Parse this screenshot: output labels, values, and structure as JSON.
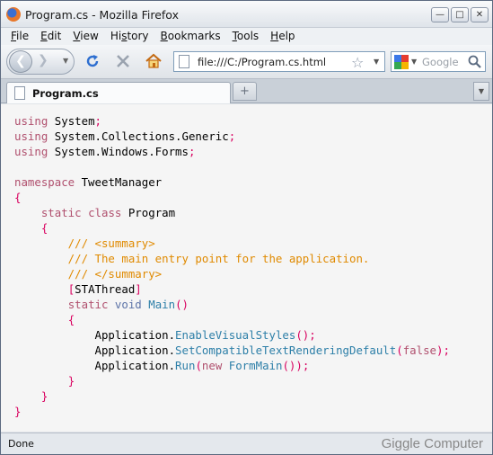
{
  "window": {
    "title": "Program.cs - Mozilla Firefox",
    "buttons": [
      "minimize",
      "maximize",
      "close"
    ]
  },
  "menubar": {
    "items": [
      {
        "label": "File",
        "key": "F",
        "rest": "ile"
      },
      {
        "label": "Edit",
        "key": "E",
        "rest": "dit"
      },
      {
        "label": "View",
        "key": "V",
        "rest": "iew"
      },
      {
        "label": "History",
        "key": "S",
        "pre": "Hi",
        "rest": "tory"
      },
      {
        "label": "Bookmarks",
        "key": "B",
        "rest": "ookmarks"
      },
      {
        "label": "Tools",
        "key": "T",
        "rest": "ools"
      },
      {
        "label": "Help",
        "key": "H",
        "rest": "elp"
      }
    ]
  },
  "navbar": {
    "url": "file:///C:/Program.cs.html",
    "search_placeholder": "Google",
    "icons": [
      "back-icon",
      "forward-icon",
      "reload-icon",
      "stop-icon",
      "home-icon",
      "bookmark-star-icon",
      "google-icon",
      "magnifier-icon"
    ]
  },
  "tabs": [
    {
      "label": "Program.cs",
      "active": true
    }
  ],
  "newtab_symbol": "+",
  "code": {
    "language": "C#",
    "lines": [
      "using System;",
      "using System.Collections.Generic;",
      "using System.Windows.Forms;",
      "",
      "namespace TweetManager",
      "{",
      "    static class Program",
      "    {",
      "        /// <summary>",
      "        /// The main entry point for the application.",
      "        /// </summary>",
      "        [STAThread]",
      "        static void Main()",
      "        {",
      "            Application.EnableVisualStyles();",
      "            Application.SetCompatibleTextRenderingDefault(false);",
      "            Application.Run(new FormMain());",
      "        }",
      "    }",
      "}"
    ]
  },
  "status": {
    "text": "Done",
    "watermark": "Giggle Computer"
  },
  "colors": {
    "keyword": "#b0506e",
    "punctuation": "#d9005f",
    "comment": "#e08a00",
    "method": "#2d7fa8",
    "background": "#f5f5f5"
  }
}
